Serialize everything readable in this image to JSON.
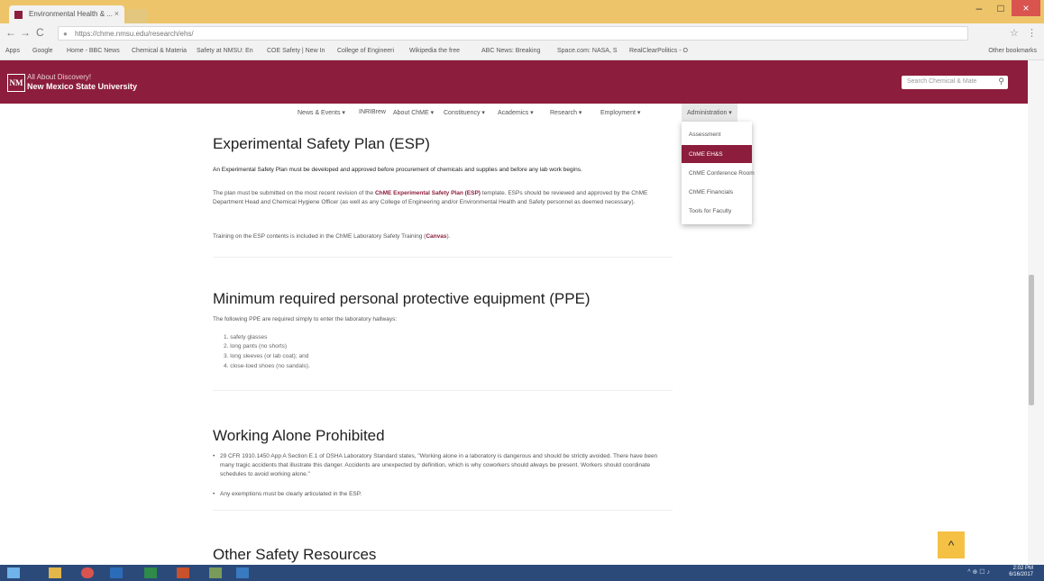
{
  "browser": {
    "tab_title": "Environmental Health & ...",
    "tab_close": "×",
    "url": "https://chme.nmsu.edu/research/ehs/",
    "back": "←",
    "forward": "→",
    "reload": "C",
    "minimize": "–",
    "maximize": "□",
    "close": "×",
    "star": "☆",
    "menu": "⋮",
    "bookmarks": [
      "Apps",
      "Google",
      "Home - BBC News",
      "Chemical & Materia",
      "Safety at NMSU: En",
      "COE Safety | New In",
      "College of Engineeri",
      "Wikipedia the free",
      "ABC News: Breaking",
      "Space.com: NASA, S",
      "RealClearPolitics - O"
    ],
    "other_bookmarks": "Other bookmarks"
  },
  "site": {
    "logo": "NM",
    "tagline": "All About Discovery!",
    "university": "New Mexico State University",
    "search_placeholder": "Search Chemical & Mate",
    "search_icon": "⚲",
    "nav": [
      "News & Events ▾",
      "INRIBrew",
      "About ChME ▾",
      "Constituency ▾",
      "Academics ▾",
      "Research ▾",
      "Employment ▾",
      "Administration ▾"
    ],
    "dropdown": [
      "Assessment",
      "ChME EH&S",
      "ChME Conference Room",
      "ChME Financials",
      "Tools for Faculty"
    ],
    "active_dropdown": "ChME EH&S"
  },
  "content": {
    "esp": {
      "title": "Experimental Safety Plan (ESP)",
      "p1": "An Experimental Safety Plan must be developed and approved before procurement of chemicals and supplies and before any lab work begins.",
      "p2_pre": "The plan must be submitted on the most recent revision of the ",
      "p2_link": "ChME Experimental Safety Plan (ESP)",
      "p2_post": " template. ESPs should be reviewed and approved by the ChME Department Head and Chemical Hygiene Officer (as well as any College of Engineering and/or Environmental Health and Safety personnel as deemed necessary).",
      "p3_pre": "Training on the ESP contents is included in the ChME Laboratory Safety Training (",
      "p3_link": "Canvas",
      "p3_post": ")."
    },
    "ppe": {
      "title": "Minimum required personal protective equipment (PPE)",
      "intro": "The following PPE are required simply to enter the laboratory hallways:",
      "items": [
        "1. safety glasses",
        "2. long pants (no shorts)",
        "3. long sleeves (or lab coat); and",
        "4. close-toed shoes (no sandals)."
      ]
    },
    "alone": {
      "title": "Working Alone Prohibited",
      "b1": "29 CFR 1910.1450 App A Section E.1 of OSHA Laboratory Standard states, \"Working alone in a laboratory is dangerous and should be strictly avoided. There have been many tragic accidents that illustrate this danger. Accidents are unexpected by definition, which is why coworkers should always be present. Workers should coordinate schedules to avoid working alone.\"",
      "b2": "Any exemptions must be clearly articulated in the ESP."
    },
    "other": {
      "title": "Other Safety Resources"
    }
  },
  "scroll_top": "^",
  "clock": {
    "time": "2:02 PM",
    "date": "6/16/2017"
  },
  "tray": "^ ⊕ ☐ ♪"
}
